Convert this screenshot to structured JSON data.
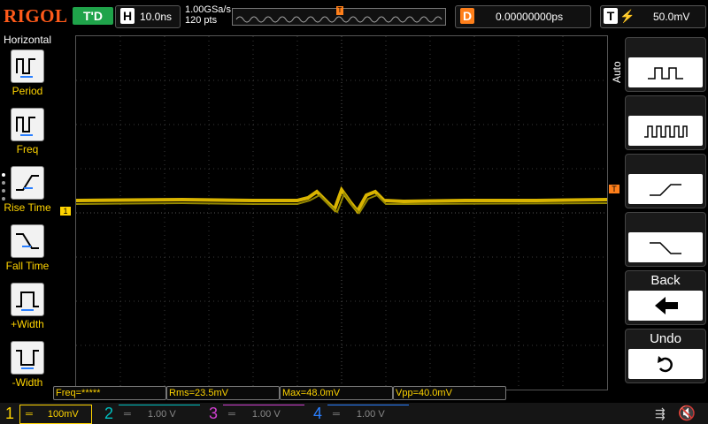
{
  "brand": "RIGOL",
  "top": {
    "run_status": "T'D",
    "timebase_letter": "H",
    "timebase": "10.0ns",
    "sample_rate": "1.00GSa/s",
    "points": "120 pts",
    "delay_letter": "D",
    "delay": "0.00000000ps",
    "trigger_letter": "T",
    "trigger_level": "50.0mV"
  },
  "left_menu": {
    "title": "Horizontal",
    "items": [
      {
        "label": "Period",
        "icon": "period-icon"
      },
      {
        "label": "Freq",
        "icon": "freq-icon"
      },
      {
        "label": "Rise Time",
        "icon": "rise-time-icon"
      },
      {
        "label": "Fall Time",
        "icon": "fall-time-icon"
      },
      {
        "label": "+Width",
        "icon": "positive-width-icon"
      },
      {
        "label": "-Width",
        "icon": "negative-width-icon"
      }
    ]
  },
  "right_menu": {
    "auto_label": "Auto",
    "back_label": "Back",
    "undo_label": "Undo"
  },
  "markers": {
    "trigger_top": "T",
    "trigger_level_right": "T",
    "channel1_left": "1"
  },
  "measurements": {
    "freq": "Freq=*****",
    "rms": "Rms=23.5mV",
    "max": "Max=48.0mV",
    "vpp": "Vpp=40.0mV"
  },
  "channels": [
    {
      "num": "1",
      "scale": "100mV",
      "color": "#ffd400"
    },
    {
      "num": "2",
      "scale": "1.00 V",
      "color": "#00c0c0"
    },
    {
      "num": "3",
      "scale": "1.00 V",
      "color": "#d040d0"
    },
    {
      "num": "4",
      "scale": "1.00 V",
      "color": "#2a7fff"
    }
  ],
  "colors": {
    "brand": "#ff5a1a",
    "run_status": "#1fa34a",
    "channel1": "#ffd400",
    "trigger": "#ff7f1a"
  }
}
